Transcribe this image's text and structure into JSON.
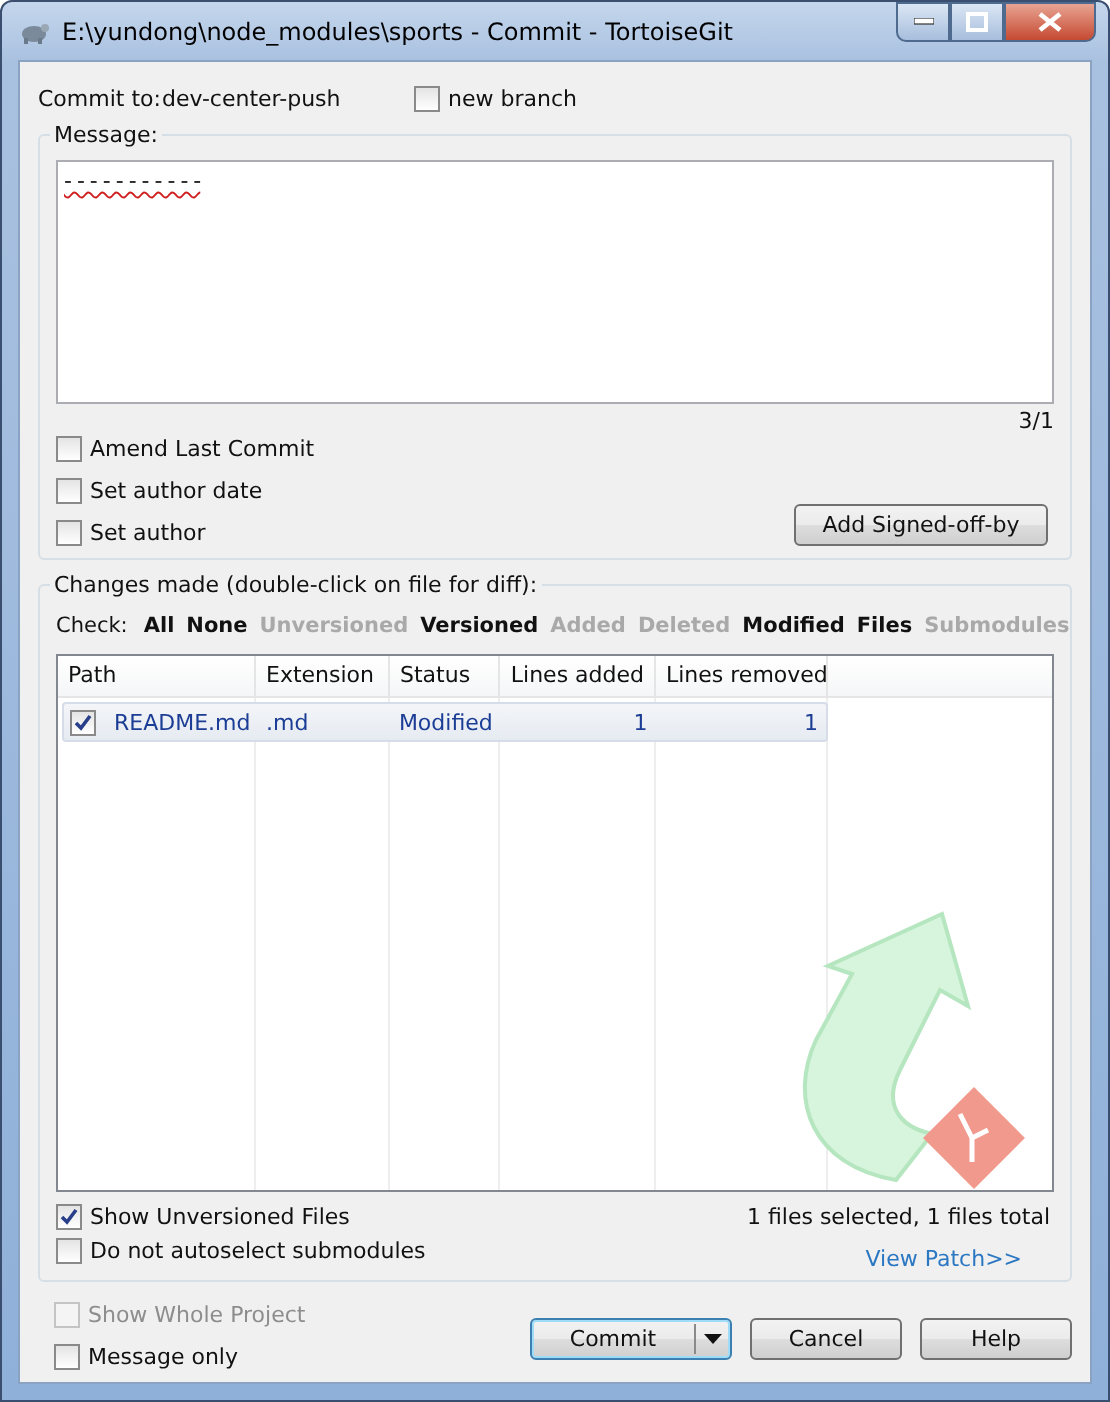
{
  "window": {
    "title": "E:\\yundong\\node_modules\\sports - Commit - TortoiseGit"
  },
  "commit_to": {
    "label": "Commit to:",
    "branch": "dev-center-push",
    "new_branch": {
      "label": "new branch",
      "checked": false
    }
  },
  "message": {
    "label": "Message:",
    "text": "- - - - - - - - - - -",
    "counter": "3/1"
  },
  "options": [
    {
      "label": "Amend Last Commit",
      "checked": false
    },
    {
      "label": "Set author date",
      "checked": false
    },
    {
      "label": "Set author",
      "checked": false
    }
  ],
  "signoff_button": "Add Signed-off-by",
  "changes": {
    "label": "Changes made (double-click on file for diff):",
    "check_label": "Check:",
    "filters": [
      {
        "label": "All",
        "disabled": false
      },
      {
        "label": "None",
        "disabled": false
      },
      {
        "label": "Unversioned",
        "disabled": true
      },
      {
        "label": "Versioned",
        "disabled": false
      },
      {
        "label": "Added",
        "disabled": true
      },
      {
        "label": "Deleted",
        "disabled": true
      },
      {
        "label": "Modified",
        "disabled": false
      },
      {
        "label": "Files",
        "disabled": false
      },
      {
        "label": "Submodules",
        "disabled": true
      }
    ],
    "columns": [
      "Path",
      "Extension",
      "Status",
      "Lines added",
      "Lines removed"
    ],
    "rows": [
      {
        "checked": true,
        "selected": true,
        "path": "README.md",
        "extension": ".md",
        "status": "Modified",
        "lines_added": "1",
        "lines_removed": "1"
      }
    ]
  },
  "list_options": [
    {
      "label": "Show Unversioned Files",
      "checked": true
    },
    {
      "label": "Do not autoselect submodules",
      "checked": false
    }
  ],
  "summary": "1 files selected, 1 files total",
  "view_patch": "View Patch>>",
  "footer_options": [
    {
      "label": "Show Whole Project",
      "checked": false,
      "disabled": true
    },
    {
      "label": "Message only",
      "checked": false,
      "disabled": false
    }
  ],
  "buttons": [
    {
      "label": "Commit",
      "kind": "split",
      "focused": true
    },
    {
      "label": "Cancel",
      "kind": "plain",
      "focused": false
    },
    {
      "label": "Help",
      "kind": "plain",
      "focused": false
    }
  ]
}
